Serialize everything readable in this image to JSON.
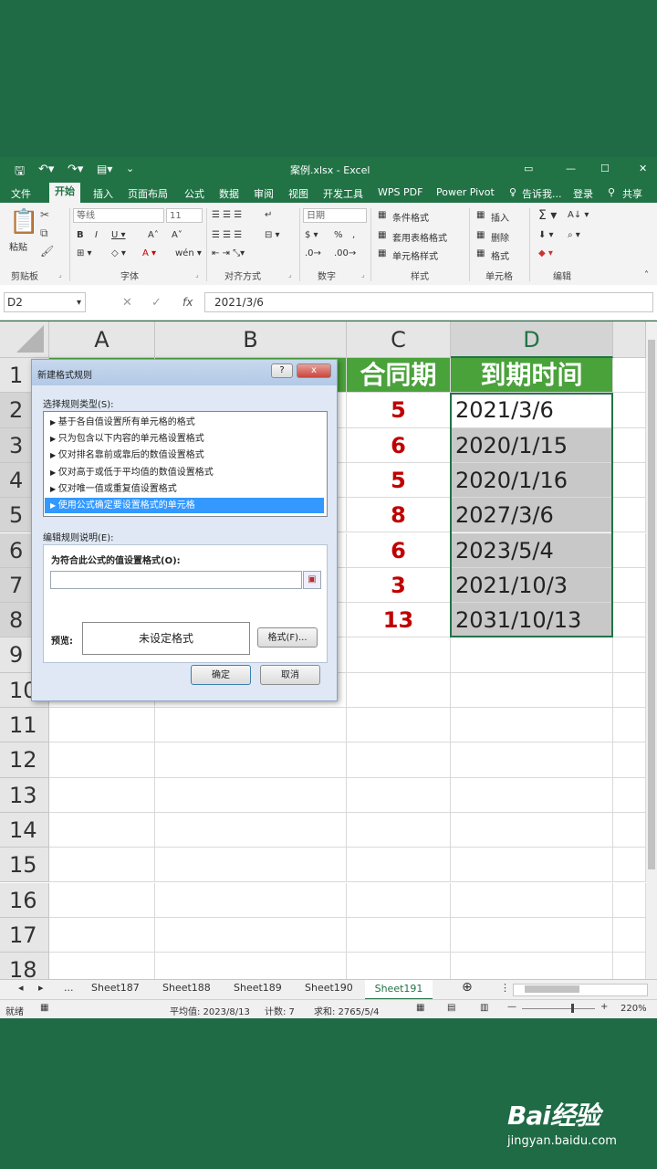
{
  "titlebar": {
    "filename": "案例.xlsx - Excel"
  },
  "tabs": [
    "文件",
    "开始",
    "插入",
    "页面布局",
    "公式",
    "数据",
    "审阅",
    "视图",
    "开发工具",
    "WPS PDF",
    "Power Pivot",
    "告诉我...",
    "登录",
    "共享"
  ],
  "ribbon": {
    "font_name": "等线",
    "font_size": "11",
    "number_format": "日期",
    "paste": "粘贴",
    "groups": [
      "剪贴板",
      "字体",
      "对齐方式",
      "数字",
      "样式",
      "单元格",
      "编辑"
    ],
    "styles": [
      "条件格式",
      "套用表格格式",
      "单元格样式"
    ],
    "cells": [
      "插入",
      "删除",
      "格式"
    ],
    "percent": "%"
  },
  "formula": {
    "namebox": "D2",
    "fx": "fx",
    "value": "2021/3/6"
  },
  "grid": {
    "columns": [
      "A",
      "B",
      "C",
      "D"
    ],
    "rows": [
      "1",
      "2",
      "3",
      "4",
      "5",
      "6",
      "7",
      "8",
      "9",
      "10",
      "11",
      "12",
      "13",
      "14",
      "15",
      "16",
      "17",
      "18"
    ],
    "header_c": "合同期",
    "header_d": "到期时间",
    "c_values": [
      "5",
      "6",
      "5",
      "8",
      "6",
      "3",
      "13"
    ],
    "d_values": [
      "2021/3/6",
      "2020/1/15",
      "2020/1/16",
      "2027/3/6",
      "2023/5/4",
      "2021/10/3",
      "2031/10/13"
    ]
  },
  "dialog": {
    "title": "新建格式规则",
    "select_label": "选择规则类型(S):",
    "rules": [
      "基于各自值设置所有单元格的格式",
      "只为包含以下内容的单元格设置格式",
      "仅对排名靠前或靠后的数值设置格式",
      "仅对高于或低于平均值的数值设置格式",
      "仅对唯一值或重复值设置格式",
      "使用公式确定要设置格式的单元格"
    ],
    "edit_label": "编辑规则说明(E):",
    "formula_label": "为符合此公式的值设置格式(O):",
    "preview_label": "预览:",
    "preview_text": "未设定格式",
    "format_button": "格式(F)...",
    "ok_button": "确定",
    "cancel_button": "取消",
    "help": "?",
    "close": "x"
  },
  "sheets": {
    "more": "...",
    "names": [
      "Sheet187",
      "Sheet188",
      "Sheet189",
      "Sheet190",
      "Sheet191"
    ],
    "active": "Sheet191"
  },
  "status": {
    "ready": "就绪",
    "average": "平均值: 2023/8/13",
    "count": "计数: 7",
    "sum": "求和: 2765/5/4",
    "zoom": "220%"
  },
  "watermark": {
    "brand": "Bai经验",
    "url": "jingyan.baidu.com"
  }
}
